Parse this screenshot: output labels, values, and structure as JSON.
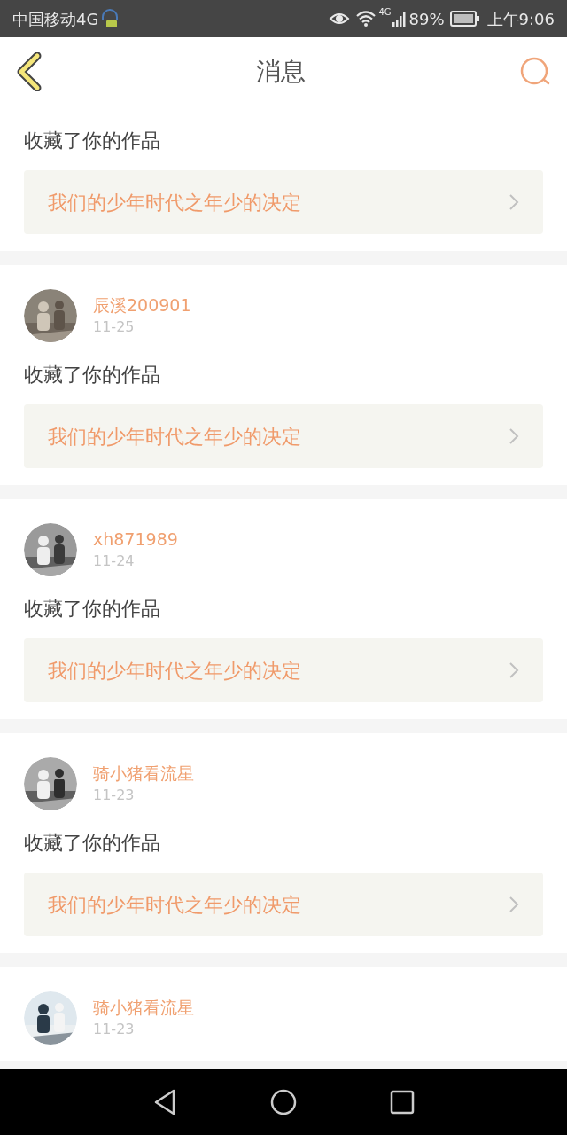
{
  "status_bar": {
    "carrier": "中国移动4G",
    "network": "4G",
    "battery": "89%",
    "time": "上午9:06"
  },
  "header": {
    "title": "消息"
  },
  "messages": [
    {
      "action": "收藏了你的作品",
      "work": "我们的少年时代之年少的决定"
    },
    {
      "user": "辰溪200901",
      "date": "11-25",
      "action": "收藏了你的作品",
      "work": "我们的少年时代之年少的决定"
    },
    {
      "user": "xh871989",
      "date": "11-24",
      "action": "收藏了你的作品",
      "work": "我们的少年时代之年少的决定"
    },
    {
      "user": "骑小猪看流星",
      "date": "11-23",
      "action": "收藏了你的作品",
      "work": "我们的少年时代之年少的决定"
    },
    {
      "user": "骑小猪看流星",
      "date": "11-23"
    }
  ]
}
